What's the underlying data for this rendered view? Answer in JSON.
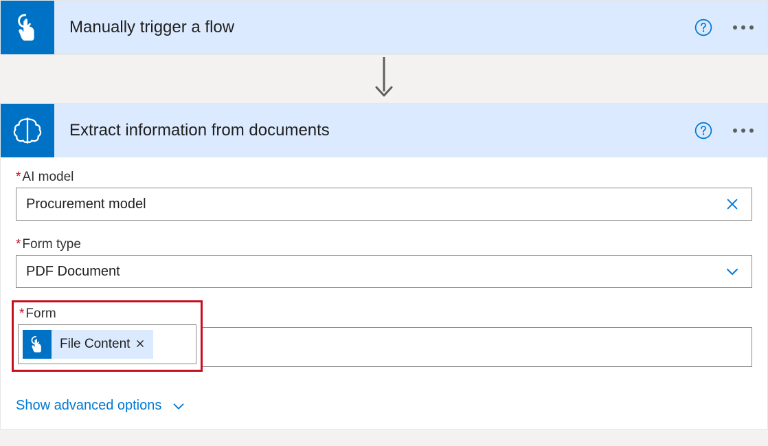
{
  "trigger": {
    "title": "Manually trigger a flow",
    "iconName": "touch-icon"
  },
  "action": {
    "title": "Extract information from documents",
    "iconName": "ai-brain-icon",
    "fields": {
      "aiModel": {
        "label": "AI model",
        "required": true,
        "value": "Procurement model"
      },
      "formType": {
        "label": "Form type",
        "required": true,
        "value": "PDF Document"
      },
      "form": {
        "label": "Form",
        "required": true,
        "token": {
          "label": "File Content",
          "source": "Manually trigger a flow",
          "iconName": "touch-icon"
        }
      }
    },
    "showAdvancedLabel": "Show advanced options"
  }
}
